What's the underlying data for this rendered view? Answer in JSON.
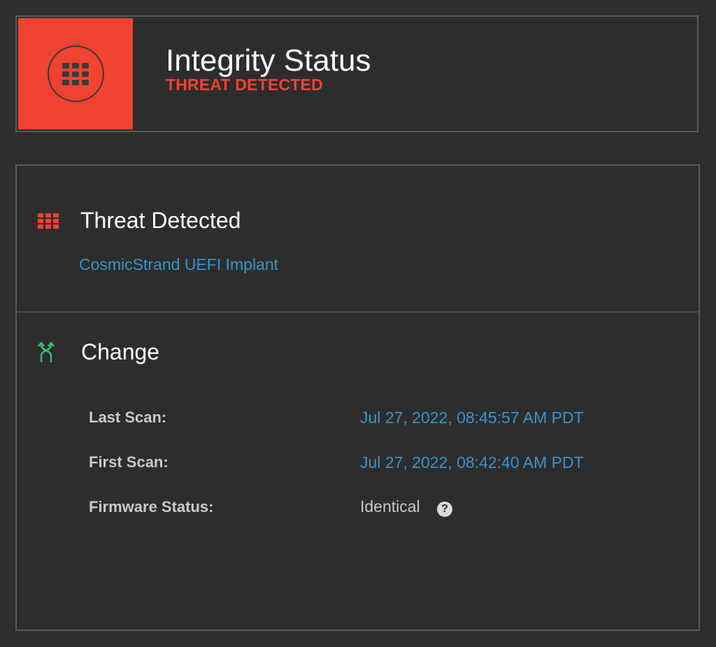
{
  "integrity": {
    "title": "Integrity Status",
    "status": "THREAT DETECTED",
    "status_color": "#f04332",
    "tile_icon": "grid-icon"
  },
  "threat_section": {
    "title": "Threat Detected",
    "icon": "grid-icon",
    "threat_name": "CosmicStrand UEFI Implant",
    "link_color": "#3a94d0"
  },
  "change_section": {
    "title": "Change",
    "icon": "change-arrows-icon",
    "icon_color": "#3fb86a",
    "rows": [
      {
        "label": "Last Scan:",
        "value": "Jul 27, 2022, 08:45:57 AM PDT"
      },
      {
        "label": "First Scan:",
        "value": "Jul 27, 2022, 08:42:40 AM PDT"
      },
      {
        "label": "Firmware Status:",
        "value": "Identical",
        "help_icon": "question-circle-icon"
      }
    ]
  }
}
